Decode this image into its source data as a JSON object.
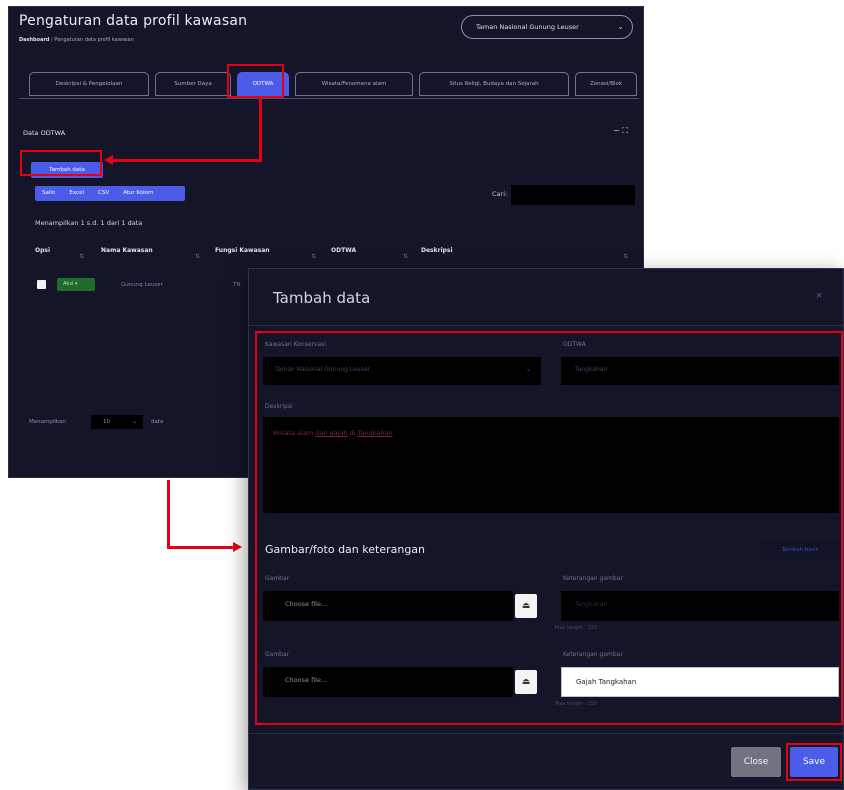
{
  "app": {
    "title": "Pengaturan data profil kawasan",
    "breadcrumb_home": "Dashboard",
    "breadcrumb_rest": "/ Pengaturan data profil kawasan",
    "area_select": "Taman Nasional Gunung Leuser"
  },
  "tabs": [
    {
      "label": "Deskripsi & Pengelolaan"
    },
    {
      "label": "Sumber Daya"
    },
    {
      "label": "ODTWA"
    },
    {
      "label": "Wisata/Fenomena alam"
    },
    {
      "label": "Situs Religi, Budaya dan Sejarah"
    },
    {
      "label": "Zonasi/Blok"
    }
  ],
  "section": {
    "title": "Data ODTWA",
    "controls": "− ⛶"
  },
  "buttons": {
    "add": "Tambah data"
  },
  "export_buttons": [
    "Salin",
    "Excel",
    "CSV",
    "Atur Kolom"
  ],
  "search": {
    "label": "Cari:"
  },
  "table": {
    "info": "Menampilkan 1 s.d. 1 dari 1 data",
    "headers": [
      "Opsi",
      "Nama Kawasan",
      "Fungsi Kawasan",
      "ODTWA",
      "Deskripsi"
    ],
    "row": {
      "action": "Aksi ▾",
      "name": "Gunung Leuser",
      "fungsi": "TN"
    }
  },
  "footer": {
    "show": "Menampilkan",
    "size": "10",
    "suffix": "data"
  },
  "modal": {
    "title": "Tambah data",
    "close_x": "×",
    "kawasan_label": "Kawasan Konservasi",
    "kawasan_value": "Taman Nasional Gunung Leuser",
    "odtwa_label": "ODTWA",
    "odtwa_placeholder": "Tangkahan",
    "deskripsi_label": "Deskripsi",
    "deskripsi_parts": [
      "Wisata ",
      "alam ",
      "dan ",
      "gajah",
      " di ",
      "Tangkahan"
    ],
    "gallery_title": "Gambar/foto dan keterangan",
    "add_row": "Tambah baris",
    "rows": [
      {
        "file_label": "Gambar",
        "file_placeholder": "Choose file...",
        "cap_label": "Keterangan gambar",
        "cap_placeholder": "Tangkahan",
        "maxlen": "Max length : 255"
      },
      {
        "file_label": "Gambar",
        "file_placeholder": "Choose file...",
        "cap_label": "Keterangan gambar",
        "cap_value": "Gajah Tangkahan",
        "maxlen": "Max length : 255"
      }
    ],
    "close_button": "Close",
    "save_button": "Save"
  },
  "colors": {
    "accent": "#4b5ce8",
    "annotation": "#e50014",
    "panel": "#141528"
  }
}
